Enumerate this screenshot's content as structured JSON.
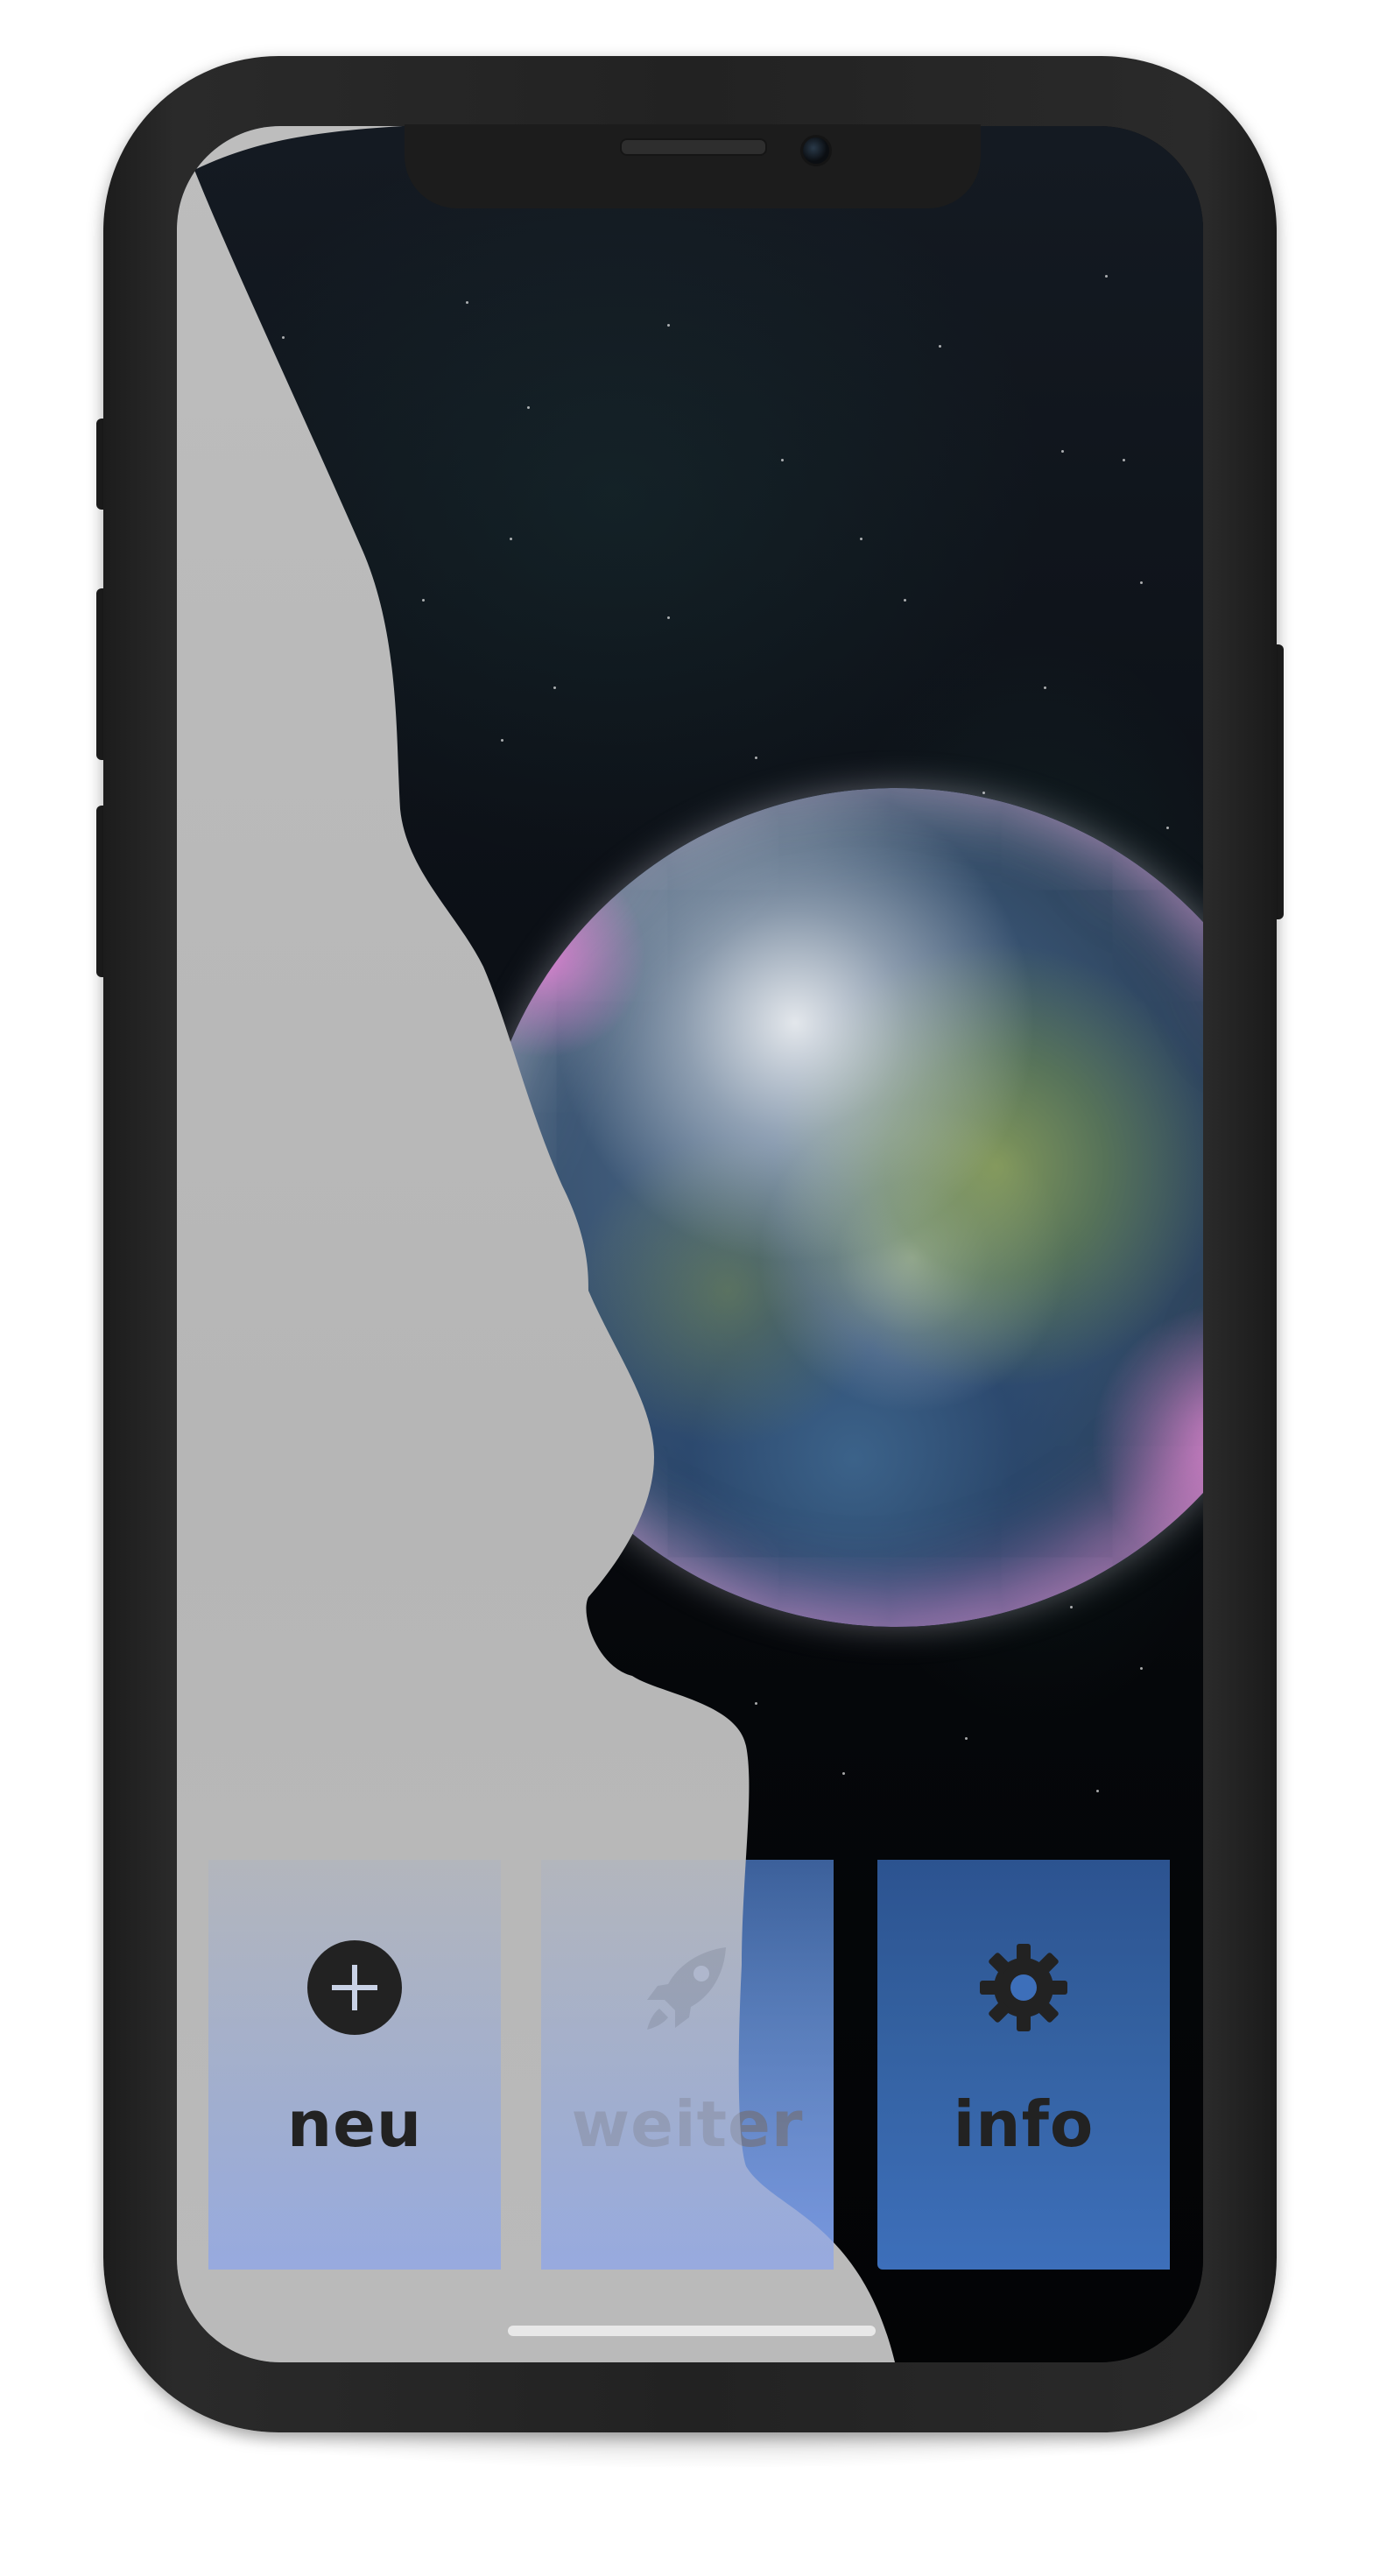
{
  "screen": {
    "background": "space-with-earth",
    "silhouette_color": "#b8b8b8"
  },
  "tabbar": {
    "accent_color": "#3d6fba",
    "tabs": [
      {
        "label": "neu",
        "icon": "plus-circle-icon",
        "state": "enabled"
      },
      {
        "label": "weiter",
        "icon": "rocket-icon",
        "state": "disabled"
      },
      {
        "label": "info",
        "icon": "gear-icon",
        "state": "enabled"
      }
    ]
  }
}
